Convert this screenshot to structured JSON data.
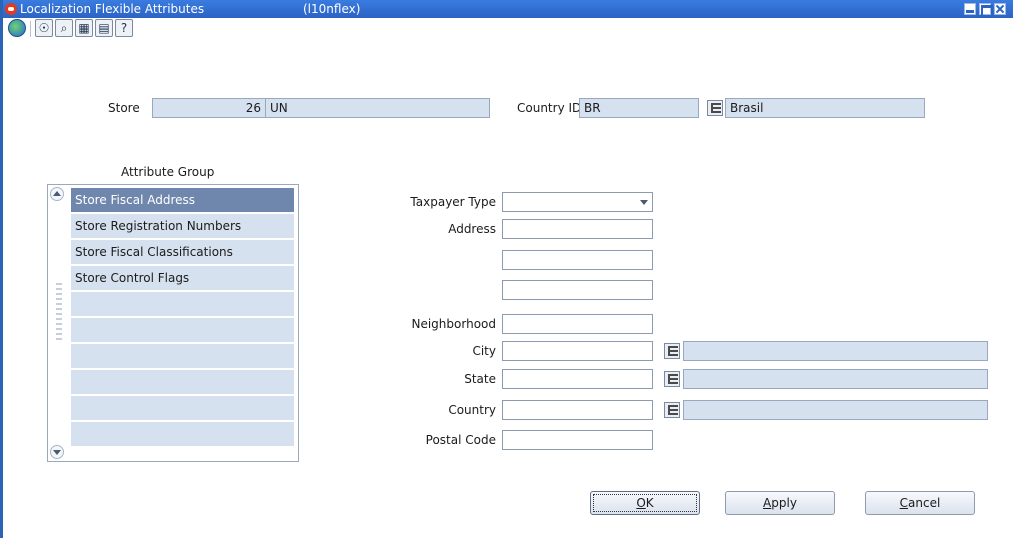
{
  "window": {
    "title": "Localization Flexible Attributes",
    "form_id": "(l10nflex)"
  },
  "toolbar": {
    "icons": [
      "globe-icon",
      "action-icon",
      "find-icon",
      "calendar-icon",
      "notes-icon",
      "help-icon"
    ],
    "glyphs": [
      "☉",
      "⌕",
      "▦",
      "▤",
      "?"
    ]
  },
  "header": {
    "store_label": "Store",
    "store_value": "26",
    "store_name": "UN",
    "country_label": "Country ID",
    "country_value": "BR",
    "country_name": "Brasil"
  },
  "attribute_group": {
    "title": "Attribute Group",
    "items": [
      {
        "label": "Store Fiscal Address",
        "selected": true
      },
      {
        "label": "Store Registration Numbers",
        "selected": false
      },
      {
        "label": "Store Fiscal Classifications",
        "selected": false
      },
      {
        "label": "Store Control Flags",
        "selected": false
      },
      {
        "label": "",
        "selected": false
      },
      {
        "label": "",
        "selected": false
      },
      {
        "label": "",
        "selected": false
      },
      {
        "label": "",
        "selected": false
      },
      {
        "label": "",
        "selected": false
      },
      {
        "label": "",
        "selected": false
      }
    ]
  },
  "form": {
    "taxpayer_type_label": "Taxpayer Type",
    "taxpayer_type_value": "",
    "address_label": "Address",
    "address_1": "",
    "address_2": "",
    "address_3": "",
    "neighborhood_label": "Neighborhood",
    "neighborhood_value": "",
    "city_label": "City",
    "city_value": "",
    "city_desc": "",
    "state_label": "State",
    "state_value": "",
    "state_desc": "",
    "country_label": "Country",
    "country_value": "",
    "country_desc": "",
    "postal_code_label": "Postal Code",
    "postal_code_value": ""
  },
  "buttons": {
    "ok_mnemonic": "O",
    "ok_rest": "K",
    "apply_mnemonic": "A",
    "apply_rest": "pply",
    "cancel_mnemonic": "C",
    "cancel_rest": "ancel"
  },
  "colors": {
    "titlebar": "#2b63c4",
    "readonly_field": "#d6e1f0",
    "selected_row": "#6f87ad"
  }
}
